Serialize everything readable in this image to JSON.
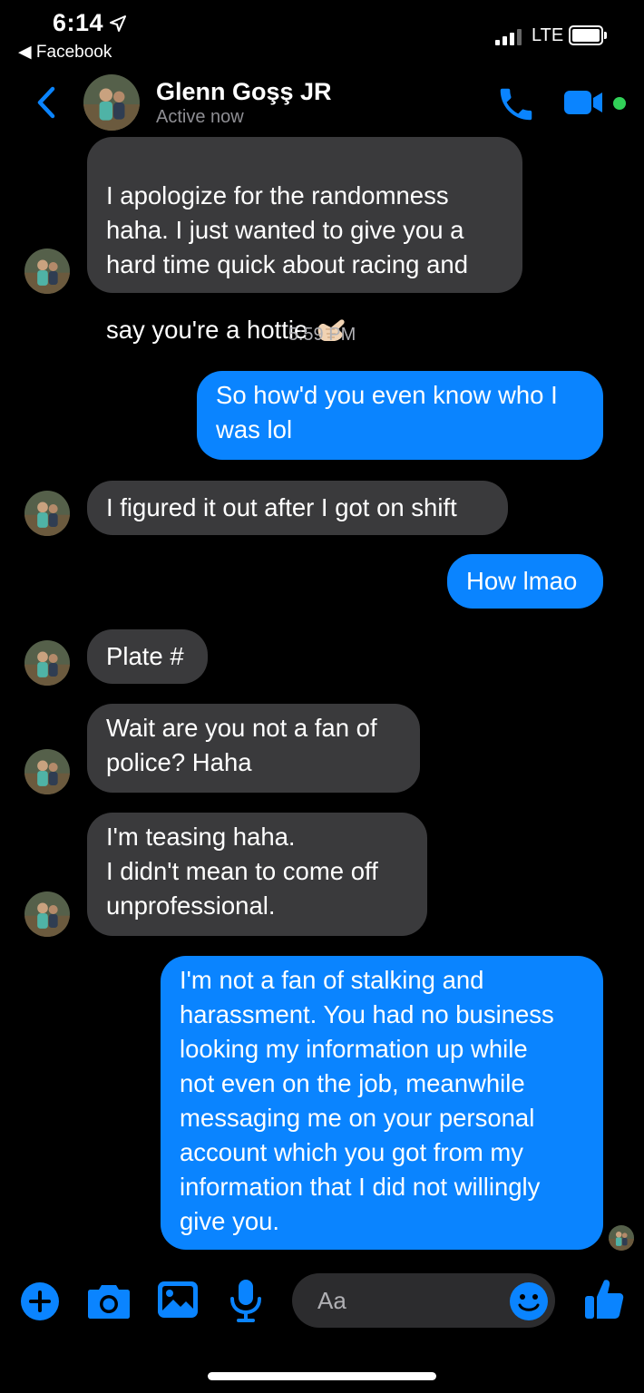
{
  "status_bar": {
    "time": "6:14",
    "back_app": "◀ Facebook",
    "carrier": "LTE"
  },
  "header": {
    "contact_name": "Glenn Goşş JR",
    "status": "Active now"
  },
  "conversation": {
    "messages": [
      {
        "from": "contact",
        "text": "I apologize for the randomness\nhaha. I just wanted to give you a\nhard time quick about racing and\nsay you're a hottie"
      },
      {
        "from": "me",
        "text": "So how'd you even know who I\nwas lol"
      },
      {
        "from": "contact",
        "text": "I figured it out after I got on shift"
      },
      {
        "from": "me",
        "text": "How lmao"
      },
      {
        "from": "contact",
        "text": "Plate #"
      },
      {
        "from": "contact",
        "text": "Wait are you not a fan of\npolice? Haha"
      },
      {
        "from": "contact",
        "text": "I'm teasing haha.\nI didn't mean to come off\nunprofessional."
      },
      {
        "from": "me",
        "text": "I'm not a fan of stalking and\nharassment. You had no business\nlooking my information up while\nnot even on the job, meanwhile\nmessaging me on your personal\naccount which you got from my\ninformation that I did not willingly\ngive you."
      }
    ],
    "timestamp": "5:59 PM",
    "emoji": "call-me-hand-emoji"
  },
  "composer": {
    "placeholder": "Aa",
    "icons": [
      "plus-icon",
      "camera-icon",
      "image-icon",
      "microphone-icon",
      "emoji-icon",
      "thumbs-up-icon"
    ]
  },
  "colors": {
    "background": "#000000",
    "incoming_bubble": "#3a3a3c",
    "outgoing_bubble": "#0a84ff",
    "accent": "#0a84ff",
    "online": "#31d158"
  }
}
